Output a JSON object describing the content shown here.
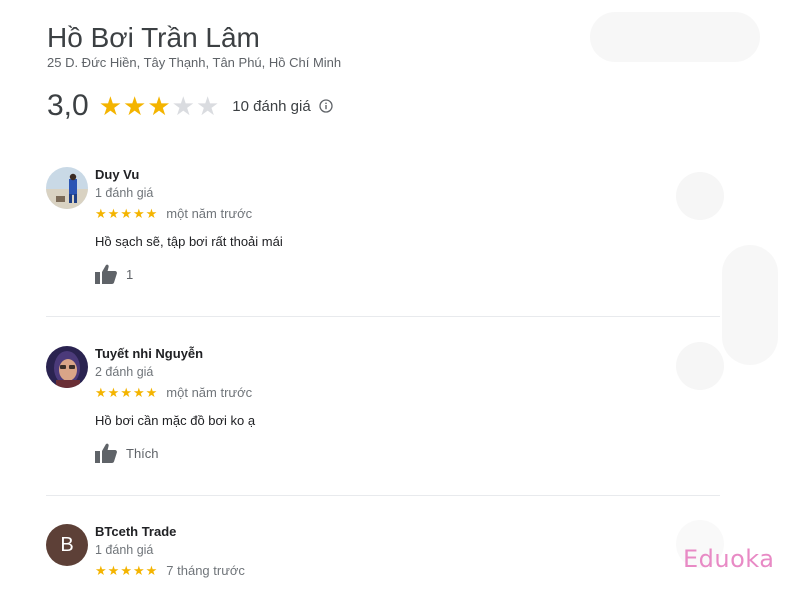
{
  "place": {
    "name": "Hồ Bơi Trần Lâm",
    "address": "25 D. Đức Hiền, Tây Thạnh, Tân Phú, Hồ Chí Minh",
    "rating": "3,0",
    "rating_stars": 3,
    "rating_out_of": 5,
    "review_count": "10 đánh giá",
    "info_icon": "info-icon"
  },
  "reviews": [
    {
      "name": "Duy Vu",
      "meta": "1 đánh giá",
      "stars": 5,
      "time": "một năm trước",
      "text": "Hồ sạch sẽ, tập bơi rất thoải mái",
      "like_label": "1",
      "avatar_type": "photo"
    },
    {
      "name": "Tuyết nhi Nguyễn",
      "meta": "2 đánh giá",
      "stars": 5,
      "time": "một năm trước",
      "text": "Hồ bơi cần mặc đồ bơi ko ạ",
      "like_label": "Thích",
      "avatar_type": "photo"
    },
    {
      "name": "BTceth Trade",
      "meta": "1 đánh giá",
      "stars": 5,
      "time": "7 tháng trước",
      "avatar_letter": "B",
      "avatar_color": "#5d4037"
    }
  ],
  "colors": {
    "star": "#f4b400",
    "star_empty": "#dadce0",
    "watermark": "#e88ac5"
  },
  "watermark": "Eduoka"
}
